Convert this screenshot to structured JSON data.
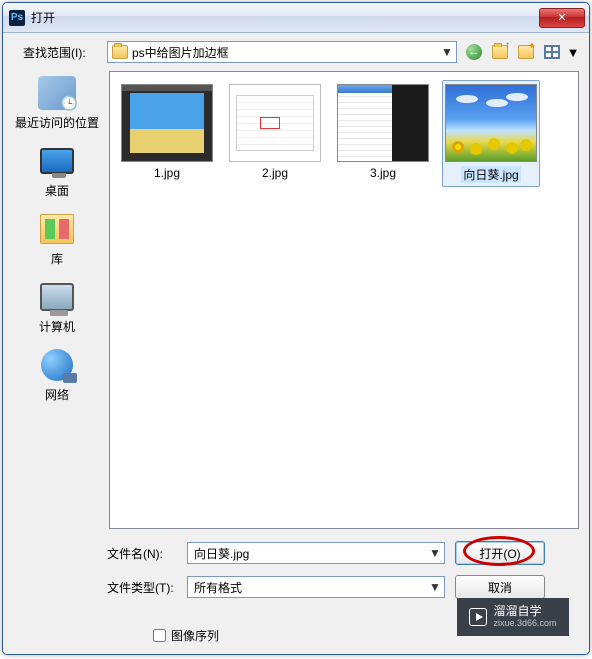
{
  "titlebar": {
    "app_icon": "Ps",
    "title": "打开",
    "close": "✕"
  },
  "lookin": {
    "label": "查找范围(I):",
    "folder": "ps中给图片加边框",
    "nav": {
      "back": "←",
      "up": "up",
      "new": "new",
      "views": "views"
    }
  },
  "places": [
    {
      "id": "recent",
      "label": "最近访问的位置"
    },
    {
      "id": "desktop",
      "label": "桌面"
    },
    {
      "id": "libraries",
      "label": "库"
    },
    {
      "id": "computer",
      "label": "计算机"
    },
    {
      "id": "network",
      "label": "网络"
    }
  ],
  "files": [
    {
      "name": "1.jpg",
      "thumb": "thumb1",
      "selected": false
    },
    {
      "name": "2.jpg",
      "thumb": "thumb2",
      "selected": false
    },
    {
      "name": "3.jpg",
      "thumb": "thumb3",
      "selected": false
    },
    {
      "name": "向日葵.jpg",
      "thumb": "thumb4",
      "selected": true
    }
  ],
  "filename": {
    "label": "文件名(N):",
    "value": "向日葵.jpg"
  },
  "filetype": {
    "label": "文件类型(T):",
    "value": "所有格式"
  },
  "buttons": {
    "open": "打开(O)",
    "cancel": "取消"
  },
  "sequence": {
    "label": "图像序列",
    "checked": false
  },
  "watermark": {
    "brand": "溜溜自学",
    "url": "zixue.3d66.com"
  }
}
